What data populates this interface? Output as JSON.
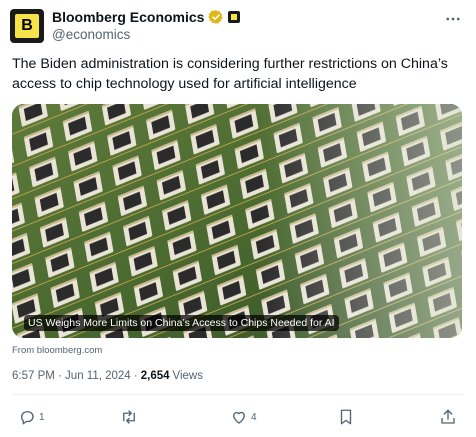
{
  "author": {
    "avatar_letter": "B",
    "display_name": "Bloomberg Economics",
    "handle": "@economics",
    "verified_color": "#e2b719"
  },
  "tweet": {
    "text": "The Biden administration is considering further restrictions on China’s access to chip technology used for artificial intelligence"
  },
  "card": {
    "headline": "US Weighs More Limits on China’s Access to Chips Needed for AI",
    "source": "From bloomberg.com"
  },
  "meta": {
    "timestamp": "6:57 PM · Jun 11, 2024 · ",
    "views_count": "2,654",
    "views_label": "Views"
  },
  "actions": {
    "replies": "1",
    "retweets": "",
    "likes": "4"
  },
  "icons": [
    "verified-icon",
    "affiliate-badge",
    "more-icon",
    "reply-icon",
    "retweet-icon",
    "like-icon",
    "bookmark-icon",
    "share-icon"
  ]
}
